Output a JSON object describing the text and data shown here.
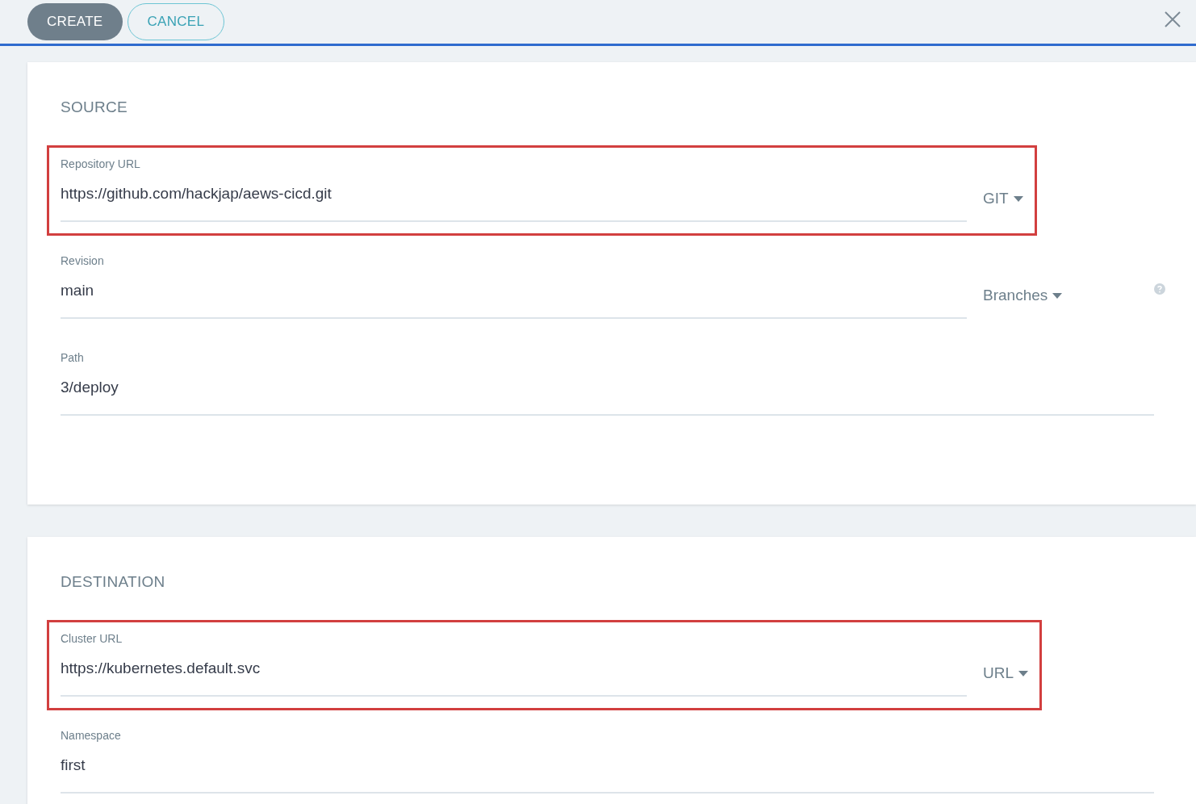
{
  "toolbar": {
    "buttons": [
      {
        "label": "CREATE",
        "kind": "primary"
      },
      {
        "label": "CANCEL",
        "kind": "outline"
      }
    ]
  },
  "sections": [
    {
      "title": "SOURCE",
      "fields": [
        {
          "label": "Repository URL",
          "value": "https://github.com/hackjap/aews-cicd.git",
          "selector": "GIT",
          "highlighted": true
        },
        {
          "label": "Revision",
          "value": "main",
          "selector": "Branches",
          "help": true,
          "highlighted": false
        },
        {
          "label": "Path",
          "value": "3/deploy",
          "highlighted": false
        }
      ]
    },
    {
      "title": "DESTINATION",
      "fields": [
        {
          "label": "Cluster URL",
          "value": "https://kubernetes.default.svc",
          "selector": "URL",
          "highlighted": true
        },
        {
          "label": "Namespace",
          "value": "first",
          "highlighted": false
        }
      ]
    }
  ]
}
